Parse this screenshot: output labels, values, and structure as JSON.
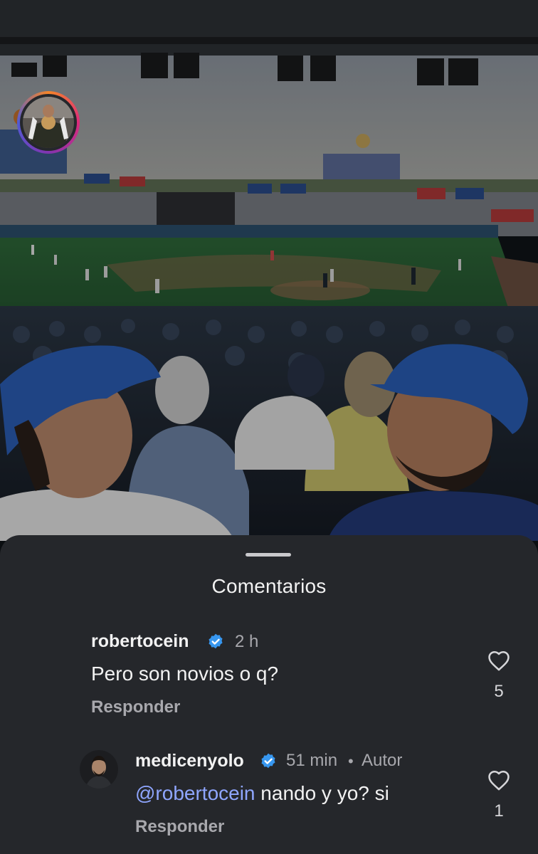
{
  "sheet": {
    "title": "Comentarios"
  },
  "comments": [
    {
      "username": "robertocein",
      "verified": true,
      "time": "2 h",
      "text": "Pero son novios o q?",
      "reply_label": "Responder",
      "likes": "5",
      "has_story_ring": true
    }
  ],
  "replies": [
    {
      "username": "medicenyolo",
      "verified": true,
      "time": "51 min",
      "separator": "•",
      "author_label": "Autor",
      "mention": "@robertocein",
      "text": " nando y yo? si",
      "reply_label": "Responder",
      "likes": "1"
    }
  ],
  "colors": {
    "sheet_background": "#25272b",
    "mention": "#8fa6ff",
    "verified_badge": "#3797f0",
    "muted_text": "#a8a8ad"
  },
  "icons": [
    "heart-icon",
    "verified-badge-icon",
    "drag-handle"
  ]
}
